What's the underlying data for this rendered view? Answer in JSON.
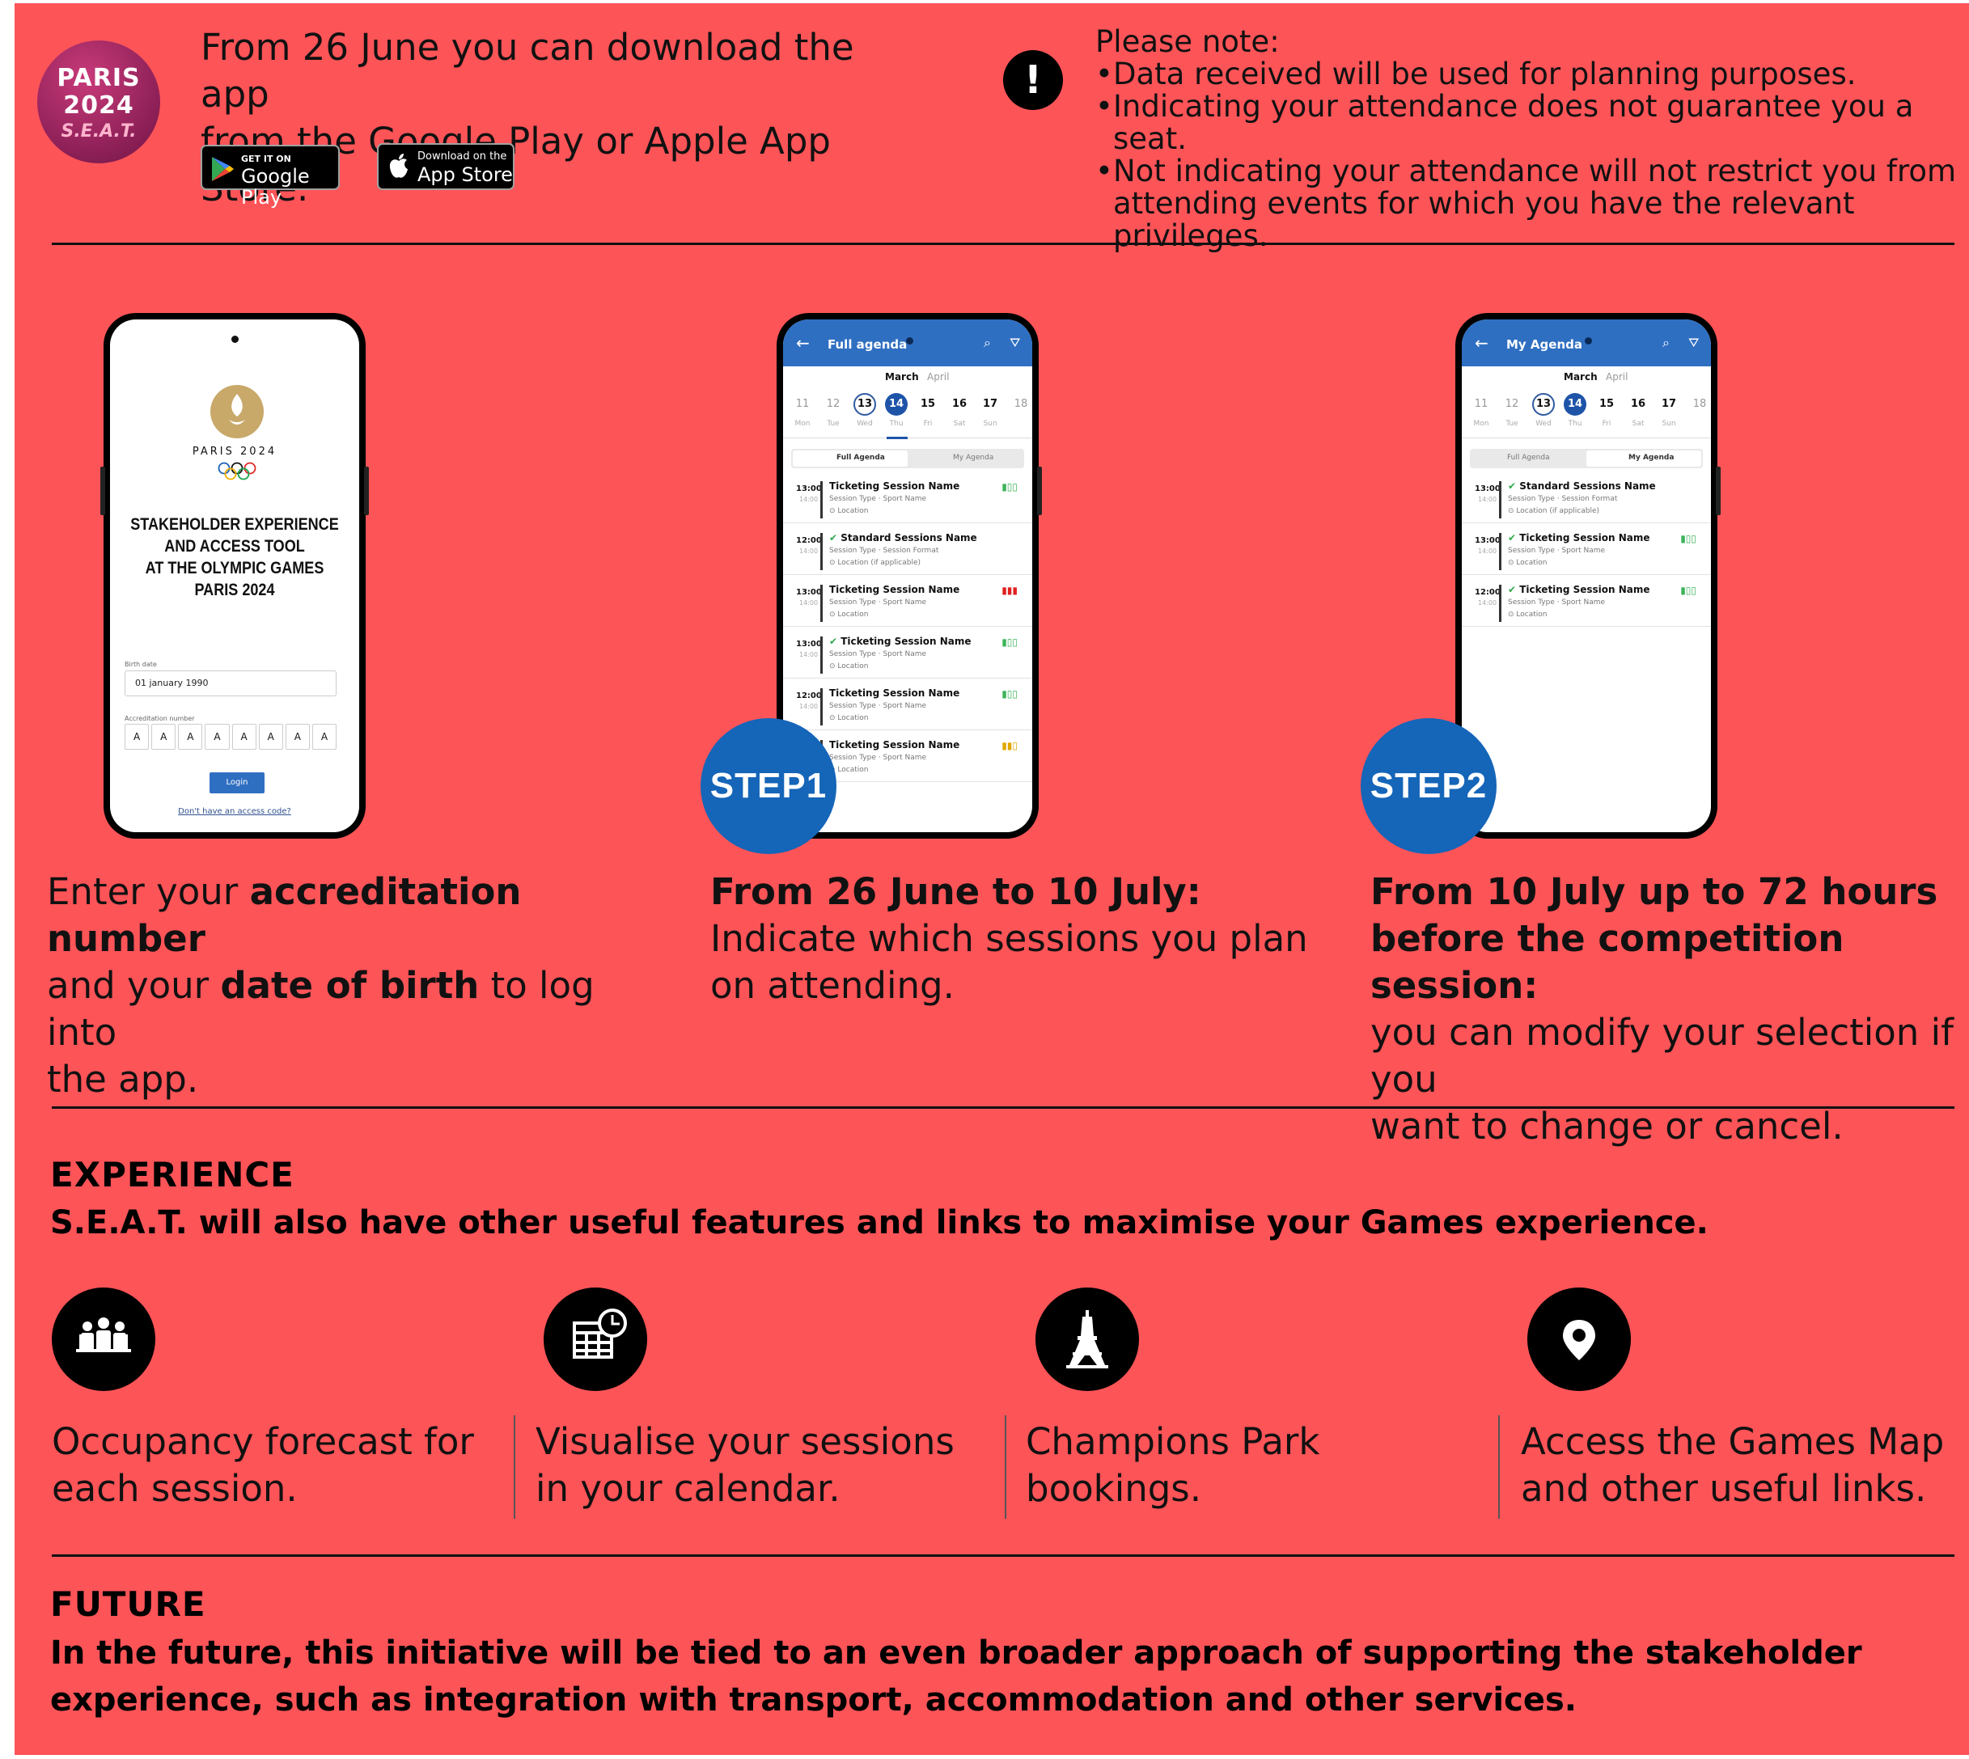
{
  "header": {
    "logo": [
      "PARIS",
      "2024",
      "S.E.A.T."
    ],
    "intro_line1": "From 26 June you can download the app",
    "intro_line2": "from the Google Play or Apple App Store.",
    "google_small": "GET IT ON",
    "google_big": "Google Play",
    "apple_small": "Download on the",
    "apple_big": "App Store",
    "note_icon": "!",
    "note_title": "Please note:",
    "notes": [
      "Data received will be used for planning purposes.",
      "Indicating your attendance does not guarantee you a seat.",
      "Not indicating your attendance will not restrict you from attending events for which you have the relevant privileges."
    ]
  },
  "login_phone": {
    "brand": "PARIS 2024",
    "title_lines": [
      "STAKEHOLDER EXPERIENCE",
      "AND ACCESS TOOL",
      "AT THE OLYMPIC GAMES",
      "PARIS 2024"
    ],
    "birth_label": "Birth date",
    "birth_value": "01 january 1990",
    "accred_label": "Accreditation number",
    "accred_chars": [
      "A",
      "A",
      "A",
      "A",
      "A",
      "A",
      "A",
      "A"
    ],
    "login_button": "Login",
    "access_link": "Don't have an access code?"
  },
  "calendar": {
    "month": "March",
    "month_next": "April",
    "days": [
      "11",
      "12",
      "13",
      "14",
      "15",
      "16",
      "17",
      "18"
    ],
    "day_names": [
      "Mon",
      "Tue",
      "Wed",
      "Thu",
      "Fri",
      "Sat",
      "Sun"
    ],
    "tab_full": "Full Agenda",
    "tab_my": "My Agenda"
  },
  "phone1": {
    "title": "Full agenda",
    "rows": [
      {
        "time": "13:00",
        "end": "14:00",
        "name": "Ticketing Session Name",
        "sub": "Session Type · Sport Name",
        "loc": "Location",
        "check": false,
        "occ": "▮▯▯",
        "occ_color": "#3cb35a"
      },
      {
        "time": "12:00",
        "end": "14:00",
        "name": "Standard Sessions Name",
        "sub": "Session Type · Session Format",
        "loc": "Location (if applicable)",
        "check": true,
        "occ": "",
        "occ_color": "#3cb35a"
      },
      {
        "time": "13:00",
        "end": "14:00",
        "name": "Ticketing Session Name",
        "sub": "Session Type · Sport Name",
        "loc": "Location",
        "check": false,
        "occ": "▮▮▮",
        "occ_color": "#e02020"
      },
      {
        "time": "13:00",
        "end": "14:00",
        "name": "Ticketing Session Name",
        "sub": "Session Type · Sport Name",
        "loc": "Location",
        "check": true,
        "occ": "▮▯▯",
        "occ_color": "#3cb35a"
      },
      {
        "time": "12:00",
        "end": "14:00",
        "name": "Ticketing Session Name",
        "sub": "Session Type · Sport Name",
        "loc": "Location",
        "check": false,
        "occ": "▮▯▯",
        "occ_color": "#3cb35a"
      },
      {
        "time": "12:00",
        "end": "14:00",
        "name": "Ticketing Session Name",
        "sub": "Session Type · Sport Name",
        "loc": "Location",
        "check": false,
        "occ": "▮▮▯",
        "occ_color": "#e0a800"
      }
    ]
  },
  "phone2": {
    "title": "My Agenda",
    "rows": [
      {
        "time": "13:00",
        "end": "14:00",
        "name": "Standard Sessions Name",
        "sub": "Session Type · Session Format",
        "loc": "Location (if applicable)",
        "check": true,
        "occ": "",
        "occ_color": "#3cb35a"
      },
      {
        "time": "13:00",
        "end": "14:00",
        "name": "Ticketing Session Name",
        "sub": "Session Type · Sport Name",
        "loc": "Location",
        "check": true,
        "occ": "▮▯▯",
        "occ_color": "#3cb35a"
      },
      {
        "time": "12:00",
        "end": "14:00",
        "name": "Ticketing Session Name",
        "sub": "Session Type · Sport Name",
        "loc": "Location",
        "check": true,
        "occ": "▮▯▯",
        "occ_color": "#3cb35a"
      }
    ]
  },
  "steps": {
    "step1": "STEP1",
    "step2": "STEP2",
    "col1_a": "Enter your ",
    "col1_b": "accreditation number",
    "col1_c": "and your ",
    "col1_d": "date of birth",
    "col1_e": " to log into",
    "col1_f": "the app.",
    "col2_a": "From 26 June to 10 July:",
    "col2_b": "Indicate which sessions you plan",
    "col2_c": "on attending.",
    "col3_a": "From 10 July up to 72 hours",
    "col3_b": "before the competition session:",
    "col3_c": "you can modify your selection if you",
    "col3_d": "want to change or cancel."
  },
  "experience": {
    "heading": "EXPERIENCE",
    "subheading": "S.E.A.T. will also have other useful features and links to maximise your Games experience.",
    "features": [
      {
        "icon": "people-icon",
        "line1": "Occupancy forecast for",
        "line2": "each session."
      },
      {
        "icon": "calendar-clock-icon",
        "line1": "Visualise your sessions",
        "line2": "in your calendar."
      },
      {
        "icon": "eiffel-tower-icon",
        "line1": "Champions Park",
        "line2": "bookings."
      },
      {
        "icon": "map-pin-icon",
        "line1": "Access the Games Map",
        "line2": "and other useful links."
      }
    ]
  },
  "future": {
    "heading": "FUTURE",
    "line1": "In the future, this initiative will be tied to an even broader approach of supporting the stakeholder",
    "line2": "experience, such as integration with transport, accommodation and other services."
  },
  "colors": {
    "background": "#fd5458",
    "step_blue": "#1565b8",
    "app_blue": "#2f6fc2"
  }
}
